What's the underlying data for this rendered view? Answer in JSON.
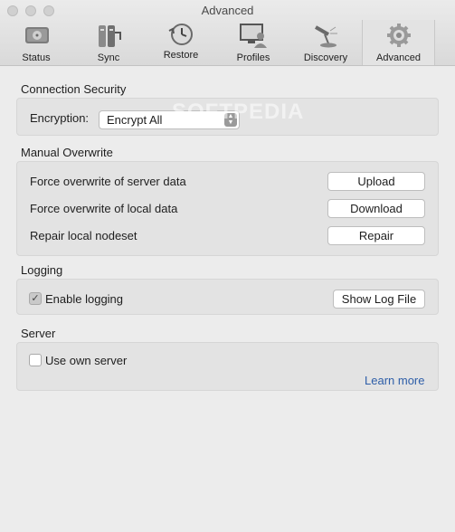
{
  "window": {
    "title": "Advanced",
    "watermark": "SOFTPEDIA"
  },
  "tabs": [
    {
      "label": "Status",
      "icon": "hard-drive-icon"
    },
    {
      "label": "Sync",
      "icon": "sync-icon"
    },
    {
      "label": "Restore",
      "icon": "restore-clock-icon"
    },
    {
      "label": "Profiles",
      "icon": "profiles-icon"
    },
    {
      "label": "Discovery",
      "icon": "discovery-lamp-icon"
    },
    {
      "label": "Advanced",
      "icon": "gear-icon",
      "active": true
    }
  ],
  "connection_security": {
    "title": "Connection Security",
    "encryption_label": "Encryption:",
    "encryption_value": "Encrypt All"
  },
  "manual_overwrite": {
    "title": "Manual Overwrite",
    "rows": [
      {
        "label": "Force overwrite of server data",
        "button": "Upload"
      },
      {
        "label": "Force overwrite of local data",
        "button": "Download"
      },
      {
        "label": "Repair local nodeset",
        "button": "Repair"
      }
    ]
  },
  "logging": {
    "title": "Logging",
    "enable_label": "Enable logging",
    "enable_checked": true,
    "show_log_button": "Show Log File"
  },
  "server": {
    "title": "Server",
    "use_own_label": "Use own server",
    "use_own_checked": false,
    "learn_more": "Learn more"
  },
  "colors": {
    "link": "#2e5ea8",
    "background": "#ececec",
    "panel": "#e3e3e3"
  }
}
